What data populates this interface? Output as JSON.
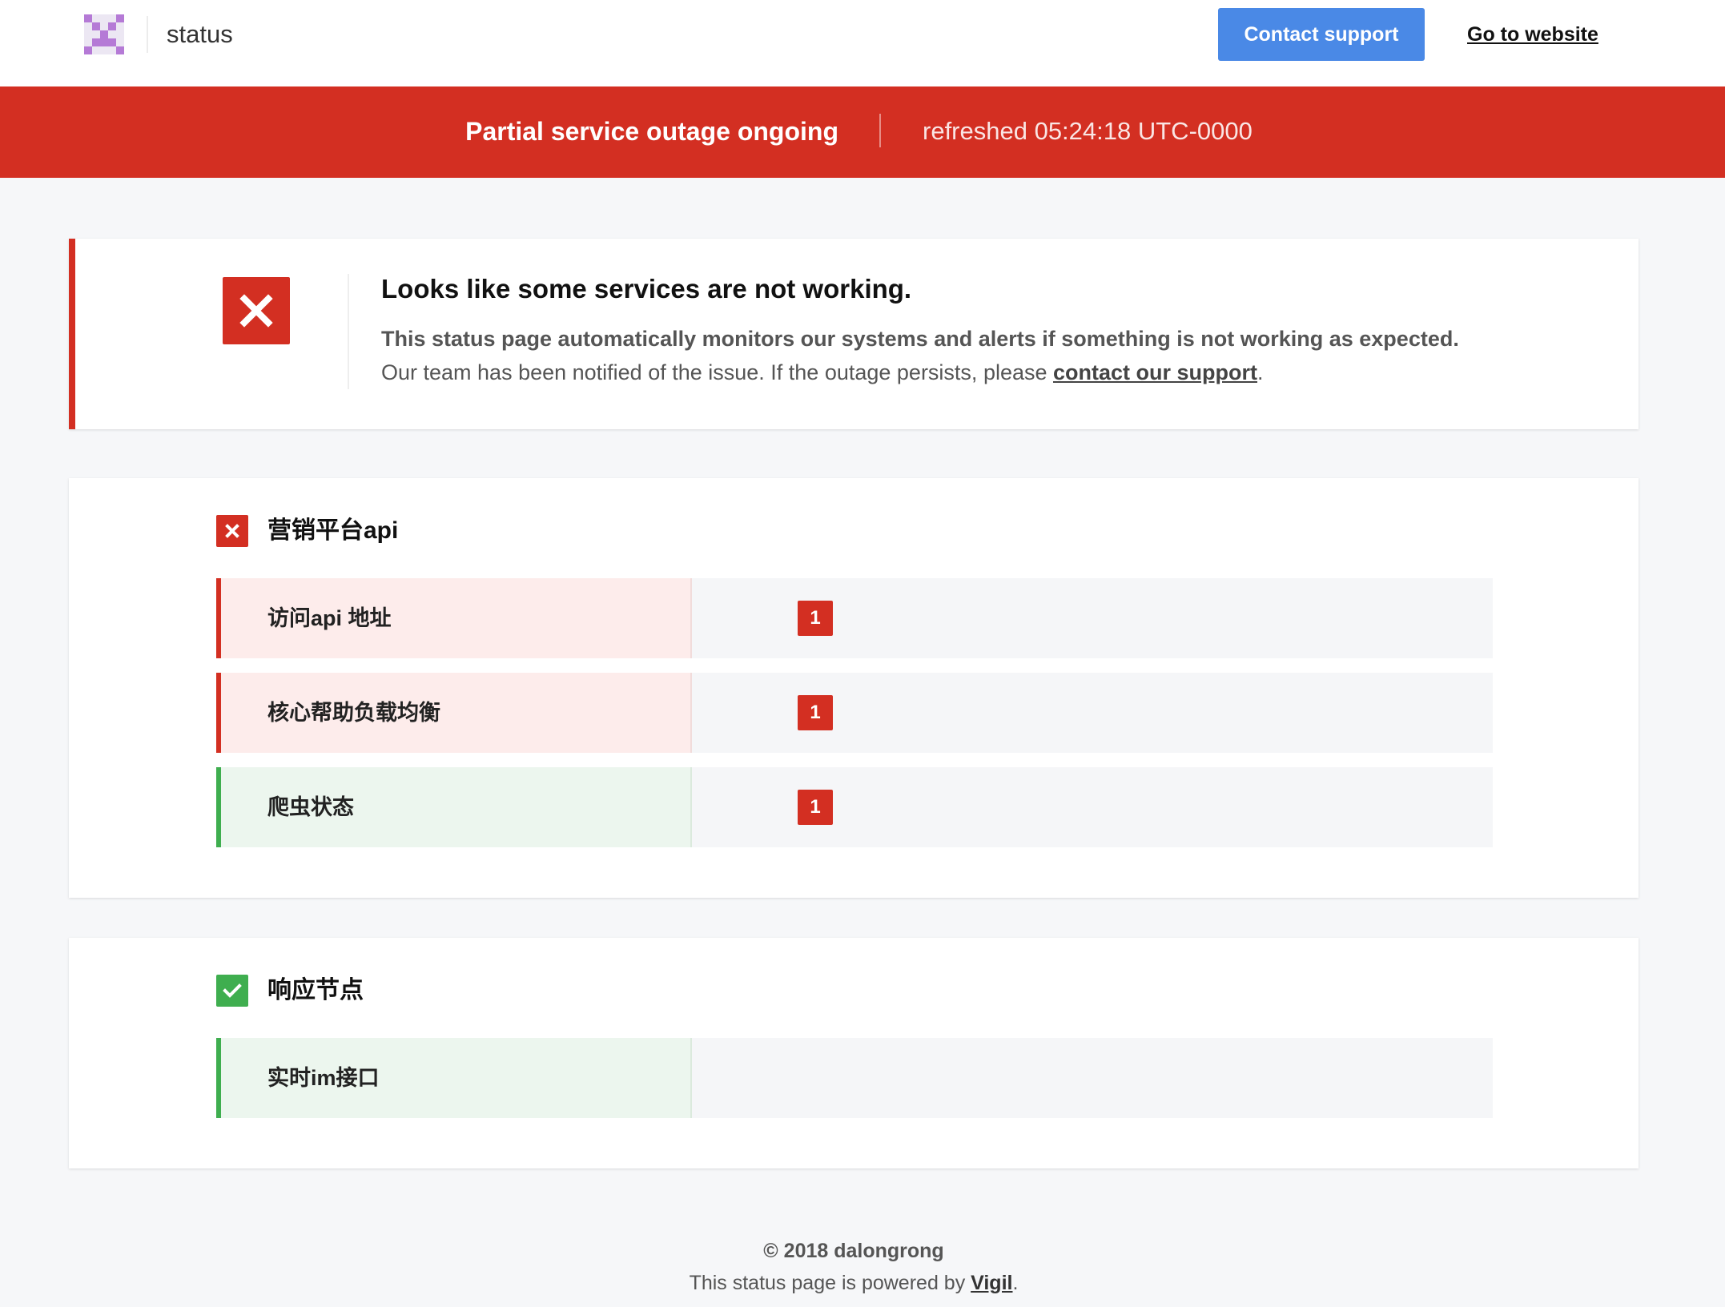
{
  "header": {
    "site_name": "status",
    "contact_button": "Contact support",
    "website_link": "Go to website",
    "contact_button_color": "#4a89e6"
  },
  "banner": {
    "title": "Partial service outage ongoing",
    "refreshed": "refreshed 05:24:18 UTC-0000",
    "color": "#d32f22"
  },
  "alert": {
    "icon": "close-icon",
    "heading": "Looks like some services are not working.",
    "line1": "This status page automatically monitors our systems and alerts if something is not working as expected.",
    "line2_prefix": "Our team has been notified of the issue. If the outage persists, please ",
    "line2_link": "contact our support",
    "line2_suffix": "."
  },
  "services": [
    {
      "title": "营销平台api",
      "status": "dead",
      "icon": "close-icon",
      "nodes": [
        {
          "label": "访问api 地址",
          "status": "dead",
          "replicas": "1"
        },
        {
          "label": "核心帮助负载均衡",
          "status": "dead",
          "replicas": "1"
        },
        {
          "label": "爬虫状态",
          "status": "healthy",
          "replicas": "1"
        }
      ]
    },
    {
      "title": "响应节点",
      "status": "healthy",
      "icon": "check-icon",
      "nodes": [
        {
          "label": "实时im接口",
          "status": "healthy"
        }
      ]
    }
  ],
  "status_colors": {
    "dead": "#d32f22",
    "healthy": "#3fae4f"
  },
  "footer": {
    "copyright": "© 2018 dalongrong",
    "powered_prefix": "This status page is powered by ",
    "powered_link": "Vigil",
    "powered_suffix": "."
  }
}
